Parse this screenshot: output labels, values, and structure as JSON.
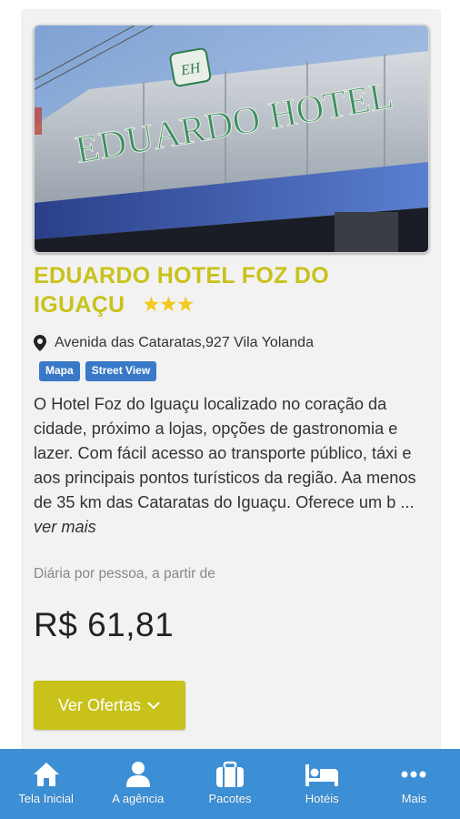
{
  "hotel": {
    "title": "EDUARDO HOTEL FOZ DO IGUAÇU",
    "stars": "★★★",
    "address": "Avenida das Cataratas,927 Vila Yolanda",
    "tags": {
      "map": "Mapa",
      "street_view": "Street View"
    },
    "description": "O Hotel Foz do Iguaçu localizado no coração da cidade, próximo a lojas, opções de gastronomia e lazer. Com fácil acesso ao transporte público, táxi e aos principais pontos turísticos da região. Aa menos de 35 km das Cataratas do Iguaçu. Oferece um b ...",
    "see_more": "ver mais",
    "price_caption": "Diária por pessoa, a partir de",
    "price": "R$ 61,81",
    "offers_button": "Ver Ofertas",
    "sign_text": "EDUARDO HOTEL",
    "sign_logo": "EH"
  },
  "nav": {
    "home": "Tela Inicial",
    "agency": "A agência",
    "packages": "Pacotes",
    "hotels": "Hotéis",
    "more": "Mais"
  },
  "colors": {
    "title": "#c8c21b",
    "button": "#c8c21b",
    "tag": "#3a79c8",
    "nav": "#3c8fd4",
    "stars": "#f2c91c"
  },
  "icons": [
    "map-pin-icon",
    "chevron-down-icon",
    "home-icon",
    "user-icon",
    "briefcase-icon",
    "bed-icon",
    "more-dots-icon"
  ]
}
